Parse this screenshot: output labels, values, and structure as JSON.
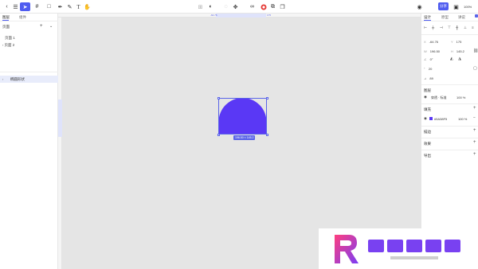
{
  "toolbar": {
    "left_icons": [
      "back-arrow-icon",
      "menu-icon",
      "pointer-tool-icon",
      "frame-tool-icon",
      "rectangle-tool-icon",
      "pen-tool-icon",
      "pencil-tool-icon",
      "text-tool-icon",
      "hand-tool-icon"
    ],
    "center_icons": [
      "component-icon",
      "mask-icon",
      "boolean-icon",
      "cut-icon",
      "link-icon",
      "fill-color-icon",
      "group-icon",
      "ungroup-icon"
    ],
    "share_label": "分享",
    "zoom": "100%"
  },
  "left_panel": {
    "tabs": [
      "图层",
      "组件"
    ],
    "pages_title": "页面",
    "pages": [
      "页面 1",
      "页面 2"
    ],
    "layer_name": "椭圆形状"
  },
  "rulers": {
    "h_start": "-64.76",
    "h_end": "175"
  },
  "canvas": {
    "background": "#e5e5e5",
    "shape_color": "#5a38f5",
    "size_label": "196.50 × 145.2"
  },
  "right_panel": {
    "tabs": [
      "设计",
      "原型",
      "讲说"
    ],
    "x_label": "X",
    "x_value": "-64.76",
    "y_label": "Y",
    "y_value": "175",
    "w_label": "W",
    "w_value": "196.50",
    "h_label": "H",
    "h_value": "145.2",
    "rotation": "0°",
    "radius": "20",
    "corner_count": "89",
    "layer_title": "图层",
    "blend_mode": "穿透 · 标准",
    "opacity": "100 %",
    "fill_title": "填充",
    "fill_hex": "#5A38F5",
    "fill_opacity": "100 %",
    "stroke_title": "描边",
    "effect_title": "效果",
    "export_title": "导出"
  }
}
